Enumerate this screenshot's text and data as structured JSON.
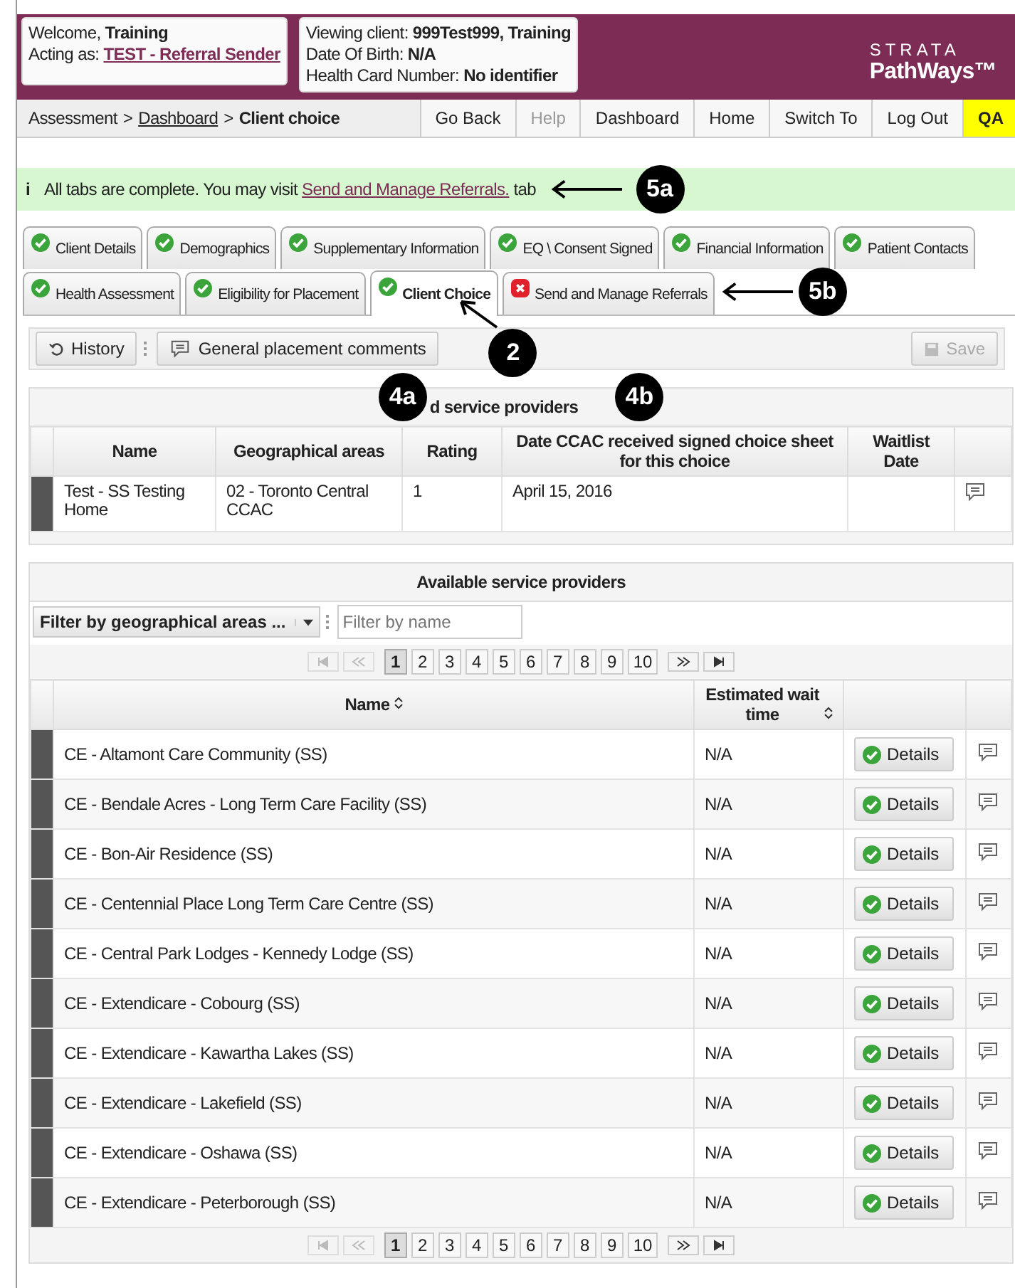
{
  "header": {
    "welcome_label": "Welcome,",
    "welcome_name": "Training",
    "acting_label": "Acting as:",
    "acting_role": "TEST - Referral Sender",
    "viewing_label": "Viewing client:",
    "viewing_value": "999Test999, Training",
    "dob_label": "Date Of Birth:",
    "dob_value": "N/A",
    "hcn_label": "Health Card Number:",
    "hcn_value": "No identifier",
    "logo_top": "STRATA",
    "logo_bottom": "PathWays™"
  },
  "breadcrumb": [
    {
      "text": "Assessment",
      "kind": "plain"
    },
    {
      "text": ">",
      "kind": "sep"
    },
    {
      "text": "Dashboard",
      "kind": "link"
    },
    {
      "text": ">",
      "kind": "sep"
    },
    {
      "text": "Client choice",
      "kind": "current"
    }
  ],
  "nav_buttons": [
    {
      "label": "Go Back",
      "disabled": false,
      "highlight": false
    },
    {
      "label": "Help",
      "disabled": true,
      "highlight": false
    },
    {
      "label": "Dashboard",
      "disabled": false,
      "highlight": false
    },
    {
      "label": "Home",
      "disabled": false,
      "highlight": false
    },
    {
      "label": "Switch To",
      "disabled": false,
      "highlight": false
    },
    {
      "label": "Log Out",
      "disabled": false,
      "highlight": false
    },
    {
      "label": "QA",
      "disabled": false,
      "highlight": true
    }
  ],
  "notice": {
    "icon": "i",
    "before": "All tabs are complete. You may visit",
    "link": "Send and Manage Referrals.",
    "after": "tab"
  },
  "tab_rows": [
    [
      {
        "label": "Client Details",
        "complete": true,
        "selected": false
      },
      {
        "label": "Demographics",
        "complete": true,
        "selected": false
      },
      {
        "label": "Supplementary Information",
        "complete": true,
        "selected": false
      },
      {
        "label": "EQ \\ Consent Signed",
        "complete": true,
        "selected": false
      },
      {
        "label": "Financial Information",
        "complete": true,
        "selected": false
      },
      {
        "label": "Patient Contacts",
        "complete": true,
        "selected": false
      }
    ],
    [
      {
        "label": "Health Assessment",
        "complete": true,
        "selected": false
      },
      {
        "label": "Eligibility for Placement",
        "complete": true,
        "selected": false
      },
      {
        "label": "Client Choice",
        "complete": true,
        "selected": true
      },
      {
        "label": "Send and Manage Referrals",
        "complete": false,
        "selected": false
      }
    ]
  ],
  "toolbar": {
    "history": "History",
    "comments": "General placement comments",
    "save": "Save",
    "save_disabled": true
  },
  "selected_providers": {
    "title": "d service providers",
    "columns": [
      "Name",
      "Geographical areas",
      "Rating",
      "Date CCAC received signed choice sheet for this choice",
      "Waitlist Date"
    ],
    "rows": [
      {
        "name": "Test - SS Testing Home",
        "area": "02 - Toronto Central CCAC",
        "rating": "1",
        "date": "April 15, 2016"
      }
    ]
  },
  "available_providers": {
    "title": "Available service providers",
    "filter_area": "Filter by geographical areas ...",
    "filter_name_placeholder": "Filter by name",
    "pager_top": [
      {
        "label": "1",
        "selected": true
      },
      {
        "label": "2",
        "selected": false
      },
      {
        "label": "3",
        "selected": false
      },
      {
        "label": "4",
        "selected": false
      },
      {
        "label": "5",
        "selected": false
      },
      {
        "label": "6",
        "selected": false
      },
      {
        "label": "7",
        "selected": false
      },
      {
        "label": "8",
        "selected": false
      },
      {
        "label": "9",
        "selected": false
      },
      {
        "label": "10",
        "selected": false
      }
    ],
    "columns": [
      "Name",
      "Estimated wait time"
    ],
    "rows": [
      {
        "name": "CE - Altamont Care Community (SS)",
        "wait": "N/A",
        "details": "Details"
      },
      {
        "name": "CE - Bendale Acres - Long Term Care Facility (SS)",
        "wait": "N/A",
        "details": "Details"
      },
      {
        "name": "CE - Bon-Air Residence (SS)",
        "wait": "N/A",
        "details": "Details"
      },
      {
        "name": "CE - Centennial Place Long Term Care Centre (SS)",
        "wait": "N/A",
        "details": "Details"
      },
      {
        "name": "CE - Central Park Lodges - Kennedy Lodge (SS)",
        "wait": "N/A",
        "details": "Details"
      },
      {
        "name": "CE - Extendicare - Cobourg (SS)",
        "wait": "N/A",
        "details": "Details"
      },
      {
        "name": "CE - Extendicare - Kawartha Lakes (SS)",
        "wait": "N/A",
        "details": "Details"
      },
      {
        "name": "CE - Extendicare - Lakefield (SS)",
        "wait": "N/A",
        "details": "Details"
      },
      {
        "name": "CE - Extendicare - Oshawa (SS)",
        "wait": "N/A",
        "details": "Details"
      },
      {
        "name": "CE - Extendicare - Peterborough (SS)",
        "wait": "N/A",
        "details": "Details"
      }
    ],
    "pager_bottom": [
      {
        "label": "1",
        "selected": true
      },
      {
        "label": "2",
        "selected": false
      },
      {
        "label": "3",
        "selected": false
      },
      {
        "label": "4",
        "selected": false
      },
      {
        "label": "5",
        "selected": false
      },
      {
        "label": "6",
        "selected": false
      },
      {
        "label": "7",
        "selected": false
      },
      {
        "label": "8",
        "selected": false
      },
      {
        "label": "9",
        "selected": false
      },
      {
        "label": "10",
        "selected": false
      }
    ]
  },
  "annotations": [
    {
      "label": "5a"
    },
    {
      "label": "5b"
    },
    {
      "label": "2"
    },
    {
      "label": "4a"
    },
    {
      "label": "4b"
    }
  ]
}
